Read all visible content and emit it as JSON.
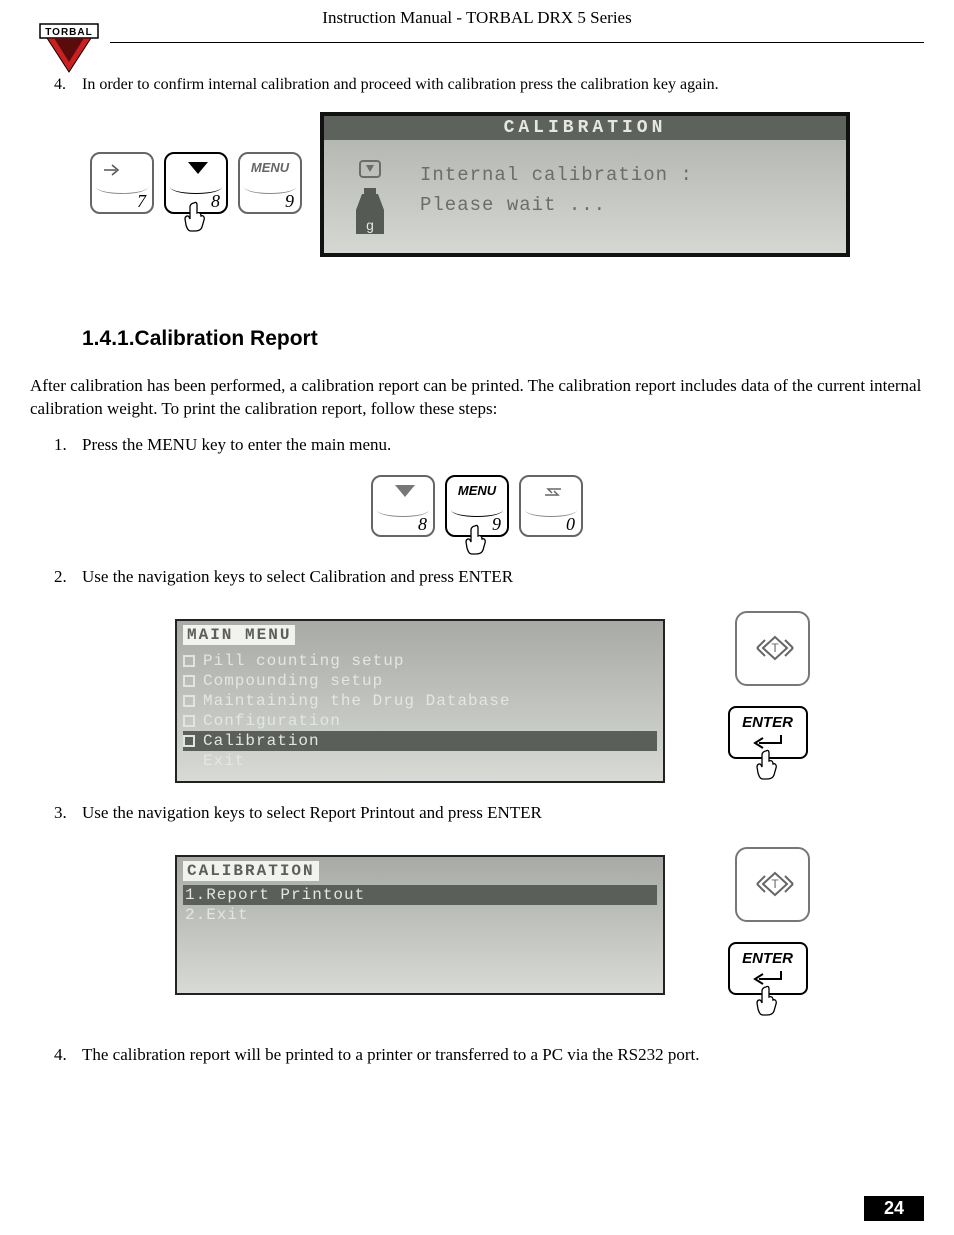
{
  "header": {
    "title": "Instruction Manual - TORBAL DRX 5 Series"
  },
  "logo": {
    "text": "TORBAL"
  },
  "intro_step": {
    "num": "4.",
    "text": "In order to confirm internal calibration and proceed with calibration press the calibration key     again."
  },
  "keys1": {
    "k7": "7",
    "k8": "8",
    "k9": "9",
    "menu": "MENU"
  },
  "lcd1": {
    "title": "CALIBRATION",
    "line1": "Internal calibration :",
    "line2": "Please wait ...",
    "weight_label": "g"
  },
  "section": {
    "num": "1.4.1.",
    "title": "Calibration Report"
  },
  "para1": "After calibration has been performed, a calibration report can be printed.  The calibration report includes data of the current internal calibration weight.   To print the calibration report, follow these steps:",
  "steps": {
    "s1": {
      "num": "1.",
      "text": "Press the MENU key to enter the main menu."
    },
    "s2": {
      "num": "2.",
      "text": "Use the navigation keys to select Calibration and press ENTER"
    },
    "s3": {
      "num": "3.",
      "text": "Use the navigation keys to select Report Printout and press ENTER"
    },
    "s4": {
      "num": "4.",
      "text": "The calibration report will be printed to a printer or transferred to a PC via the RS232 port."
    }
  },
  "keys2": {
    "k8": "8",
    "k9": "9",
    "k0": "0",
    "menu": "MENU"
  },
  "lcd_menu": {
    "title": "MAIN MENU",
    "items": [
      "Pill counting setup",
      "Compounding setup",
      "Maintaining the Drug Database",
      "Configuration",
      "Calibration",
      "Exit"
    ],
    "selected_index": 4
  },
  "lcd_cal": {
    "title": "CALIBRATION",
    "items": [
      "1.Report Printout",
      "2.Exit"
    ],
    "selected_index": 0
  },
  "enter": {
    "label": "ENTER"
  },
  "page": {
    "num": "24"
  }
}
